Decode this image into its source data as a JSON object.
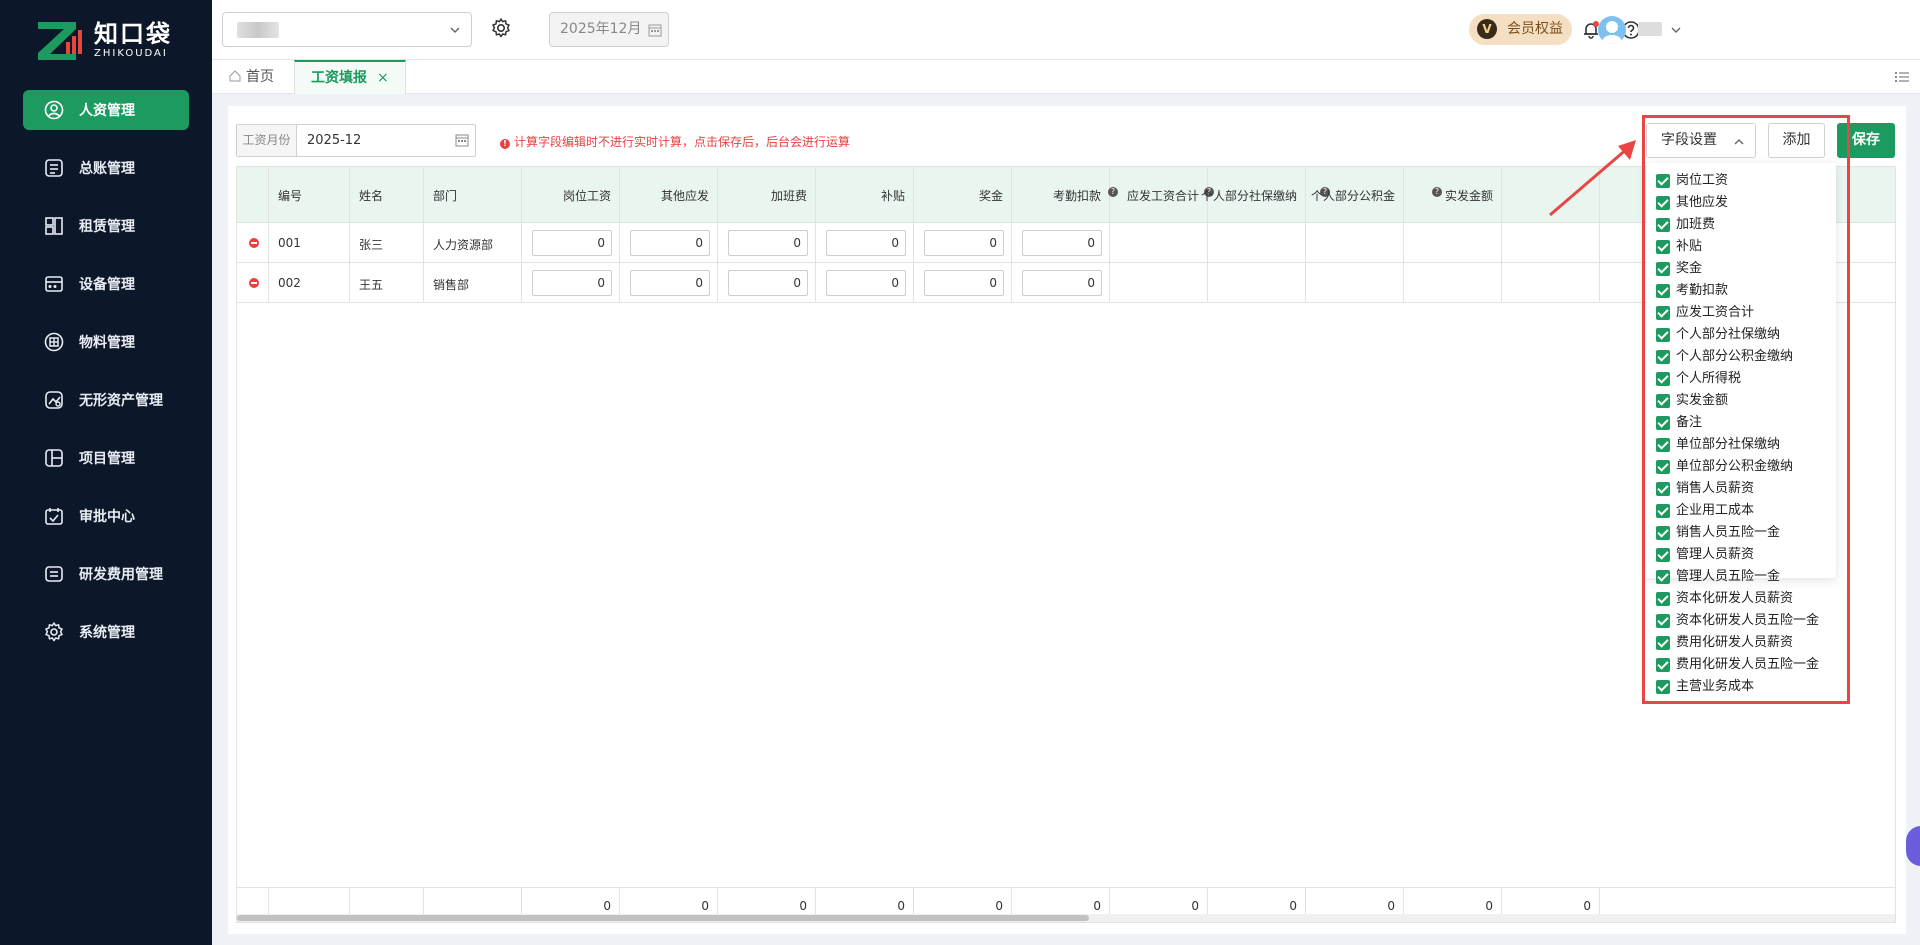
{
  "app": {
    "logo_cn": "知口袋",
    "logo_en": "ZHIKOUDAI",
    "accent": "#1c9a60"
  },
  "sidebar": {
    "items": [
      {
        "label": "人资管理",
        "icon": "user-circle-icon",
        "name": "sidebar-item-hr",
        "active": true
      },
      {
        "label": "总账管理",
        "icon": "ledger-icon",
        "name": "sidebar-item-ledger"
      },
      {
        "label": "租赁管理",
        "icon": "lease-icon",
        "name": "sidebar-item-lease"
      },
      {
        "label": "设备管理",
        "icon": "device-icon",
        "name": "sidebar-item-device"
      },
      {
        "label": "物料管理",
        "icon": "box-icon",
        "name": "sidebar-item-material"
      },
      {
        "label": "无形资产管理",
        "icon": "intangible-asset-icon",
        "name": "sidebar-item-intangible"
      },
      {
        "label": "项目管理",
        "icon": "project-icon",
        "name": "sidebar-item-project"
      },
      {
        "label": "审批中心",
        "icon": "approval-icon",
        "name": "sidebar-item-approval"
      },
      {
        "label": "研发费用管理",
        "icon": "rd-expense-icon",
        "name": "sidebar-item-rd"
      },
      {
        "label": "系统管理",
        "icon": "gear-icon",
        "name": "sidebar-item-system"
      }
    ]
  },
  "header": {
    "date": "2025年12月",
    "vip_label": "会员权益",
    "vip_badge": "V"
  },
  "tabs": {
    "home": "首页",
    "active": "工资填报",
    "close": "×"
  },
  "toolbar": {
    "month_label": "工资月份",
    "month_value": "2025-12",
    "warning": "计算字段编辑时不进行实时计算，点击保存后，后台会进行运算",
    "field_settings": "字段设置",
    "add": "添加",
    "save": "保存"
  },
  "table": {
    "columns": [
      "编号",
      "姓名",
      "部门",
      "岗位工资",
      "其他应发",
      "加班费",
      "补贴",
      "奖金",
      "考勤扣款",
      "应发工资合计",
      "个人部分社保缴纳",
      "个人部分公积金",
      "实发金额"
    ],
    "rows": [
      {
        "id": "001",
        "name": "张三",
        "dept": "人力资源部",
        "values": [
          "0",
          "0",
          "0",
          "0",
          "0",
          "0"
        ]
      },
      {
        "id": "002",
        "name": "王五",
        "dept": "销售部",
        "values": [
          "0",
          "0",
          "0",
          "0",
          "0",
          "0"
        ]
      }
    ],
    "totals": [
      "0",
      "0",
      "0",
      "0",
      "0",
      "0",
      "0",
      "0",
      "0",
      "0",
      "0"
    ]
  },
  "field_options": [
    "岗位工资",
    "其他应发",
    "加班费",
    "补贴",
    "奖金",
    "考勤扣款",
    "应发工资合计",
    "个人部分社保缴纳",
    "个人部分公积金缴纳",
    "个人所得税",
    "实发金额",
    "备注",
    "单位部分社保缴纳",
    "单位部分公积金缴纳",
    "销售人员薪资",
    "企业用工成本",
    "销售人员五险一金",
    "管理人员薪资",
    "管理人员五险一金",
    "资本化研发人员薪资",
    "资本化研发人员五险一金",
    "费用化研发人员薪资",
    "费用化研发人员五险一金",
    "主营业务成本"
  ]
}
